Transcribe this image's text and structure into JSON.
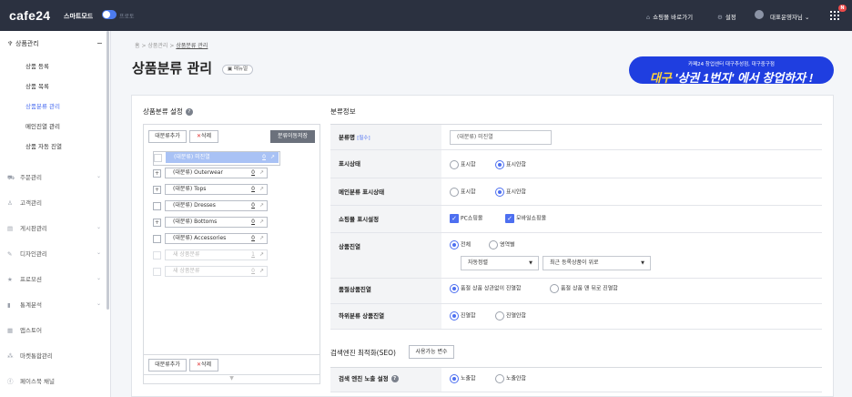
{
  "topbar": {
    "logo": "cafe24",
    "smart_mode": "스마트모드",
    "prototype": "프로토",
    "go_mall": "쇼핑몰 바로가기",
    "settings": "설정",
    "user": "대표운영자님",
    "badge": "N"
  },
  "sidebar": {
    "group_title": "상품관리",
    "sub_items": [
      "상품 등록",
      "상품 목록",
      "상품분류 관리",
      "메인진열 관리",
      "상품 자동 진열"
    ],
    "menu_items": [
      "주문관리",
      "고객관리",
      "게시판관리",
      "디자인관리",
      "프로모션",
      "통계분석",
      "앱스토어",
      "마켓통합관리",
      "페이스북 채널"
    ]
  },
  "page": {
    "breadcrumb": [
      "홈",
      "상품관리",
      "상품분류 관리"
    ],
    "title": "상품분류 관리",
    "manual": "매뉴얼"
  },
  "banner": {
    "line1": "카페24 창업센터 대구추성점, 대구중구점",
    "line2_highlight": "대구",
    "line2_rest": "'상권 1번지' 에서 창업하자 !"
  },
  "category_panel": {
    "title": "상품분류 설정",
    "add_label": "대분류추가",
    "delete_label": "삭제",
    "move_save_label": "분류이동저장",
    "items": [
      {
        "label": "(대분류) 미진열",
        "count": "0",
        "state": "selected",
        "expand": ""
      },
      {
        "label": "(대분류) Outerwear",
        "count": "0",
        "state": "normal",
        "expand": "+"
      },
      {
        "label": "(대분류) Tops",
        "count": "0",
        "state": "normal",
        "expand": "+"
      },
      {
        "label": "(대분류) Dresses",
        "count": "0",
        "state": "normal",
        "expand": ""
      },
      {
        "label": "(대분류) Bottoms",
        "count": "0",
        "state": "normal",
        "expand": "+"
      },
      {
        "label": "(대분류) Accessories",
        "count": "0",
        "state": "normal",
        "expand": ""
      },
      {
        "label": "새 상품분류",
        "count": "1",
        "state": "dim",
        "expand": ""
      },
      {
        "label": "새 상품분류",
        "count": "0",
        "state": "dim",
        "expand": ""
      }
    ]
  },
  "info_panel": {
    "title": "분류정보",
    "name_label": "분류명",
    "required": "[필수]",
    "name_value": "(대분류) 미진열",
    "display_label": "표시상태",
    "display_on": "표시함",
    "display_off": "표시안함",
    "main_display_label": "메인분류 표시상태",
    "main_on": "표시함",
    "main_off": "표시안함",
    "mall_display_label": "쇼핑몰 표시설정",
    "pc_mall": "PC쇼핑몰",
    "mobile_mall": "모바일쇼핑몰",
    "product_display_label": "상품진열",
    "all": "전체",
    "by_area": "영역별",
    "sort_select": "자동정렬",
    "order_select": "최근 등록상품이 위로",
    "soldout_label": "품절상품진열",
    "soldout_any": "품절 상품 상관없이 진열함",
    "soldout_back": "품절 상품 맨 뒤로 진열함",
    "sub_label": "하위분류 상품진열",
    "sub_on": "진열함",
    "sub_off": "진열안함"
  },
  "seo": {
    "title": "검색엔진 최적화(SEO)",
    "vars_button": "사용가능 변수",
    "expose_label": "검색 엔진 노출 설정",
    "expose_on": "노출함",
    "expose_off": "노출안함"
  }
}
